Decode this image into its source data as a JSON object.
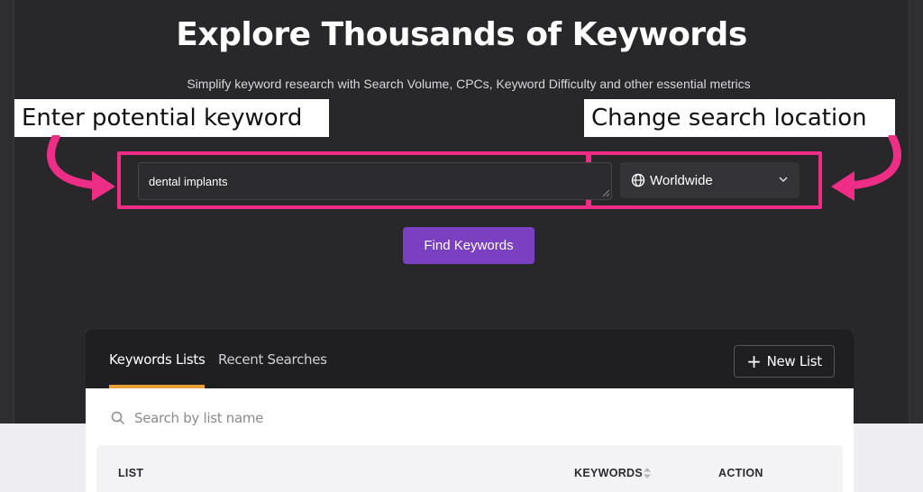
{
  "hero": {
    "title": "Explore Thousands of Keywords",
    "subtitle": "Simplify keyword research with Search Volume, CPCs, Keyword Difficulty and other essential metrics"
  },
  "callouts": {
    "left": "Enter potential keyword",
    "right": "Change search location"
  },
  "search": {
    "keyword_value": "dental implants",
    "location": "Worldwide",
    "submit_label": "Find Keywords"
  },
  "panel": {
    "tabs": [
      {
        "label": "Keywords Lists",
        "active": true
      },
      {
        "label": "Recent Searches",
        "active": false
      }
    ],
    "new_list_label": "New List",
    "search_placeholder": "Search by list name",
    "columns": [
      "LIST",
      "KEYWORDS",
      "ACTION"
    ]
  },
  "colors": {
    "highlight": "#ee2d86",
    "primary_button": "#7b3fc2",
    "tab_underline": "#e8a13a",
    "background": "#28282b"
  },
  "icons": {
    "location": "globe-icon",
    "dropdown": "chevron-down-icon",
    "panel_search": "search-icon",
    "sort": "sort-icon",
    "new_list": "plus-icon"
  }
}
